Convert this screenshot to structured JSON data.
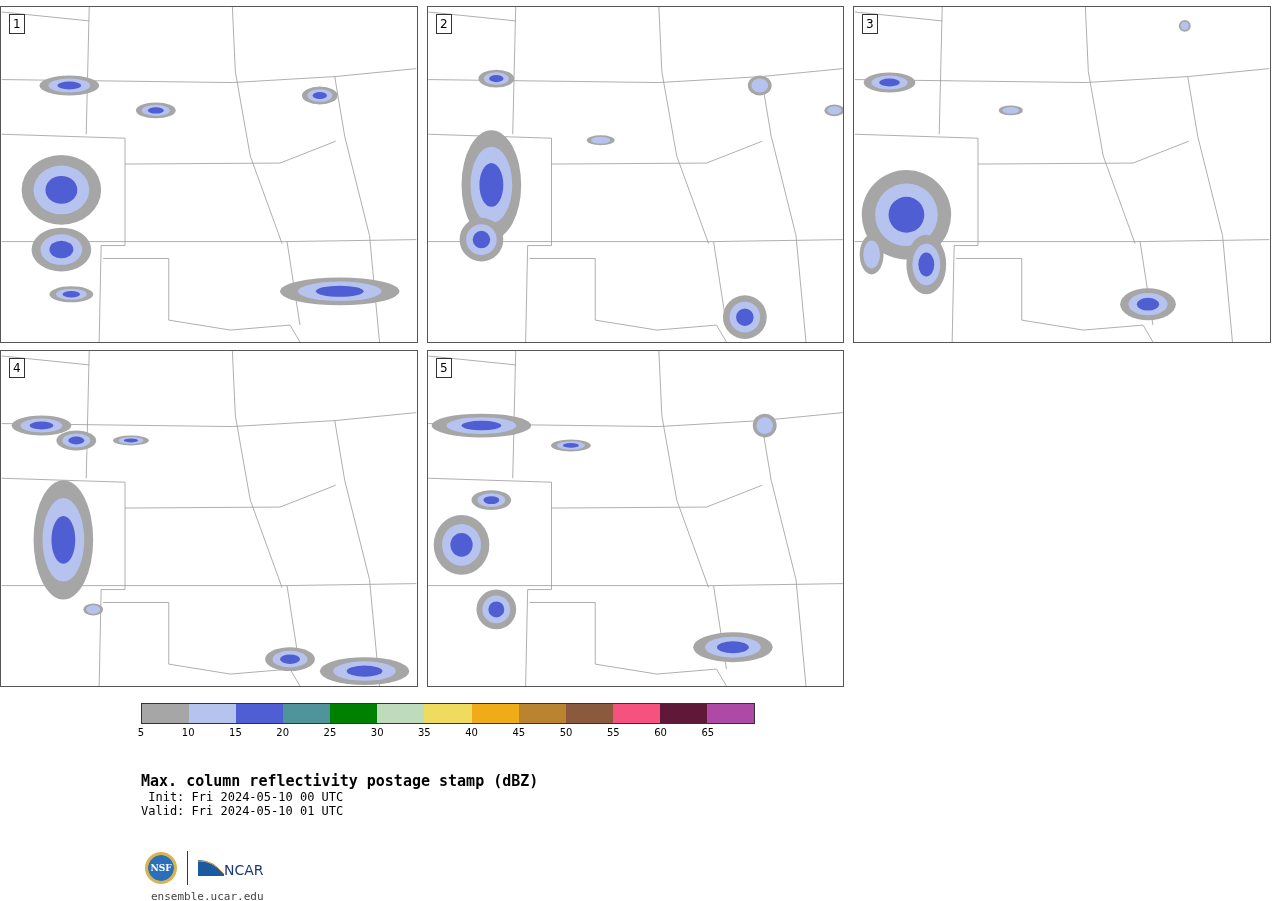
{
  "panels": [
    {
      "label": "1"
    },
    {
      "label": "2"
    },
    {
      "label": "3"
    },
    {
      "label": "4"
    },
    {
      "label": "5"
    }
  ],
  "colorbar": {
    "bins": [
      {
        "tick": "5",
        "color": "#a6a6a6"
      },
      {
        "tick": "10",
        "color": "#b6c3ee"
      },
      {
        "tick": "15",
        "color": "#505ed4"
      },
      {
        "tick": "20",
        "color": "#4e949a"
      },
      {
        "tick": "25",
        "color": "#008000"
      },
      {
        "tick": "30",
        "color": "#bedcbc"
      },
      {
        "tick": "35",
        "color": "#efdb5e"
      },
      {
        "tick": "40",
        "color": "#f0ac18"
      },
      {
        "tick": "45",
        "color": "#ba8330"
      },
      {
        "tick": "50",
        "color": "#8b5a3e"
      },
      {
        "tick": "55",
        "color": "#f5527f"
      },
      {
        "tick": "60",
        "color": "#601838"
      },
      {
        "tick": "65",
        "color": "#ae4aa6"
      }
    ]
  },
  "title": "Max. column reflectivity postage stamp (dBZ)",
  "init": " Init: Fri 2024-05-10 00 UTC",
  "valid": "Valid: Fri 2024-05-10 01 UTC",
  "logos": [
    {
      "kind": "seal",
      "text": "NSF"
    },
    {
      "kind": "wedge",
      "text": "NCAR"
    }
  ],
  "url": "ensemble.ucar.edu"
}
